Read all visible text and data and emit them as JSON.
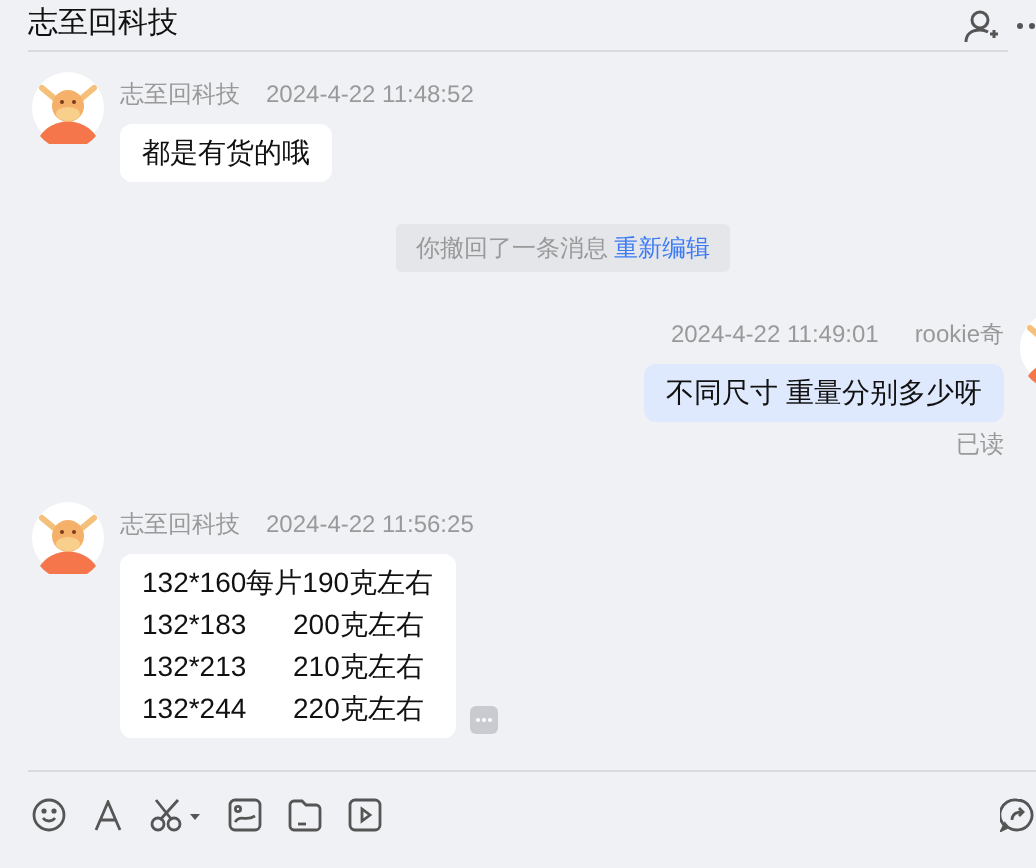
{
  "header": {
    "title": "志至回科技"
  },
  "messages": [
    {
      "kind": "incoming",
      "sender": "志至回科技",
      "time": "2024-4-22 11:48:52",
      "lines": [
        "都是有货的哦"
      ]
    },
    {
      "kind": "recall",
      "text": "你撤回了一条消息",
      "link": "重新编辑"
    },
    {
      "kind": "outgoing",
      "sender": "rookie奇",
      "time": "2024-4-22 11:49:01",
      "lines": [
        "不同尺寸 重量分别多少呀"
      ],
      "status": "已读"
    },
    {
      "kind": "incoming",
      "sender": "志至回科技",
      "time": "2024-4-22 11:56:25",
      "lines": [
        "132*160每片190克左右",
        "132*183      200克左右",
        "132*213      210克左右",
        "132*244      220克左右"
      ],
      "more": true
    }
  ]
}
